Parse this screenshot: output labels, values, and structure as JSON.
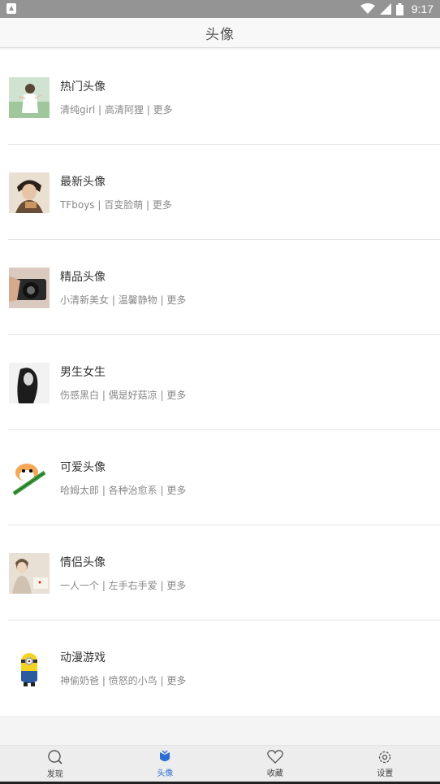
{
  "status_bar": {
    "time": "9:17"
  },
  "header": {
    "title": "头像"
  },
  "categories": [
    {
      "title": "热门头像",
      "subtitle": "清纯girl | 高清阿狸 | 更多",
      "thumb": "girl-photo"
    },
    {
      "title": "最新头像",
      "subtitle": "TFboys | 百变脸萌 | 更多",
      "thumb": "boy-photo"
    },
    {
      "title": "精品头像",
      "subtitle": "小清新美女 | 温馨静物 | 更多",
      "thumb": "camera-photo"
    },
    {
      "title": "男生女生",
      "subtitle": "伤感黑白 | 偶是好菇凉 | 更多",
      "thumb": "bw-girl-photo"
    },
    {
      "title": "可爱头像",
      "subtitle": "哈姆太郎 | 各种治愈系 | 更多",
      "thumb": "hamster-cartoon"
    },
    {
      "title": "情侣头像",
      "subtitle": "一人一个 | 左手右手爱 | 更多",
      "thumb": "couple-photo"
    },
    {
      "title": "动漫游戏",
      "subtitle": "神偷奶爸 | 愤怒的小鸟 | 更多",
      "thumb": "minion-cartoon"
    }
  ],
  "tabs": [
    {
      "label": "发现",
      "icon": "search-icon",
      "active": false
    },
    {
      "label": "头像",
      "icon": "avatar-icon",
      "active": true
    },
    {
      "label": "收藏",
      "icon": "heart-icon",
      "active": false
    },
    {
      "label": "设置",
      "icon": "gear-icon",
      "active": false
    }
  ],
  "colors": {
    "accent": "#2a6fd1",
    "status_bar": "#949494"
  }
}
